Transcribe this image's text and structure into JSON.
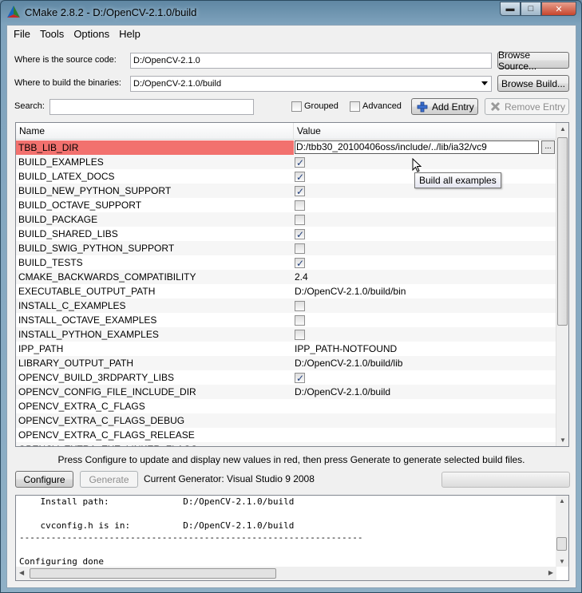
{
  "window": {
    "title": "CMake 2.8.2 - D:/OpenCV-2.1.0/build",
    "minimize_label": "▬",
    "maximize_label": "□",
    "close_label": "✕"
  },
  "menu": [
    "File",
    "Tools",
    "Options",
    "Help"
  ],
  "source": {
    "label": "Where is the source code:",
    "value": "D:/OpenCV-2.1.0",
    "browse_label": "Browse Source..."
  },
  "build": {
    "label": "Where to build the binaries:",
    "value": "D:/OpenCV-2.1.0/build",
    "browse_label": "Browse Build..."
  },
  "search": {
    "label": "Search:",
    "value": ""
  },
  "options": {
    "grouped_label": "Grouped",
    "grouped_checked": false,
    "advanced_label": "Advanced",
    "advanced_checked": false,
    "add_entry_label": "Add Entry",
    "remove_entry_label": "Remove Entry"
  },
  "table": {
    "col_name": "Name",
    "col_value": "Value",
    "rows": [
      {
        "name": "TBB_LIB_DIR",
        "value": "D:/tbb30_20100406oss/include/../lib/ia32/vc9",
        "type": "edit",
        "highlight": true
      },
      {
        "name": "BUILD_EXAMPLES",
        "value": "",
        "type": "check",
        "checked": true
      },
      {
        "name": "BUILD_LATEX_DOCS",
        "value": "",
        "type": "check",
        "checked": true
      },
      {
        "name": "BUILD_NEW_PYTHON_SUPPORT",
        "value": "",
        "type": "check",
        "checked": true
      },
      {
        "name": "BUILD_OCTAVE_SUPPORT",
        "value": "",
        "type": "check",
        "checked": false
      },
      {
        "name": "BUILD_PACKAGE",
        "value": "",
        "type": "check",
        "checked": false
      },
      {
        "name": "BUILD_SHARED_LIBS",
        "value": "",
        "type": "check",
        "checked": true
      },
      {
        "name": "BUILD_SWIG_PYTHON_SUPPORT",
        "value": "",
        "type": "check",
        "checked": false
      },
      {
        "name": "BUILD_TESTS",
        "value": "",
        "type": "check",
        "checked": true
      },
      {
        "name": "CMAKE_BACKWARDS_COMPATIBILITY",
        "value": "2.4",
        "type": "text"
      },
      {
        "name": "EXECUTABLE_OUTPUT_PATH",
        "value": "D:/OpenCV-2.1.0/build/bin",
        "type": "text"
      },
      {
        "name": "INSTALL_C_EXAMPLES",
        "value": "",
        "type": "check",
        "checked": false
      },
      {
        "name": "INSTALL_OCTAVE_EXAMPLES",
        "value": "",
        "type": "check",
        "checked": false
      },
      {
        "name": "INSTALL_PYTHON_EXAMPLES",
        "value": "",
        "type": "check",
        "checked": false
      },
      {
        "name": "IPP_PATH",
        "value": "IPP_PATH-NOTFOUND",
        "type": "text"
      },
      {
        "name": "LIBRARY_OUTPUT_PATH",
        "value": "D:/OpenCV-2.1.0/build/lib",
        "type": "text"
      },
      {
        "name": "OPENCV_BUILD_3RDPARTY_LIBS",
        "value": "",
        "type": "check",
        "checked": true
      },
      {
        "name": "OPENCV_CONFIG_FILE_INCLUDE_DIR",
        "value": "D:/OpenCV-2.1.0/build",
        "type": "text"
      },
      {
        "name": "OPENCV_EXTRA_C_FLAGS",
        "value": "",
        "type": "text"
      },
      {
        "name": "OPENCV_EXTRA_C_FLAGS_DEBUG",
        "value": "",
        "type": "text"
      },
      {
        "name": "OPENCV_EXTRA_C_FLAGS_RELEASE",
        "value": "",
        "type": "text"
      },
      {
        "name": "OPENCV_EXTRA_EXE_LINKER_FLAGS",
        "value": "",
        "type": "text"
      }
    ]
  },
  "tooltip": "Build all examples",
  "hint": "Press Configure to update and display new values in red, then press Generate to generate selected build files.",
  "actions": {
    "configure_label": "Configure",
    "generate_label": "Generate",
    "generator_text": "Current Generator: Visual Studio 9 2008",
    "progress_value": 0
  },
  "output": {
    "lines": [
      "    Install path:              D:/OpenCV-2.1.0/build",
      "",
      "    cvconfig.h is in:          D:/OpenCV-2.1.0/build",
      "-----------------------------------------------------------------",
      "",
      "Configuring done"
    ]
  }
}
